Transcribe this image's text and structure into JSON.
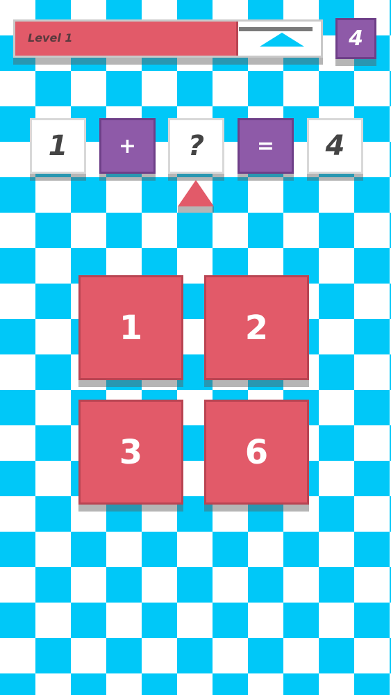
{
  "header": {
    "level_label": "Level 1",
    "progress_fraction": 0.73,
    "score": "4"
  },
  "equation": {
    "operand1": "1",
    "operator": "+",
    "unknown": "?",
    "equals": "=",
    "result": "4"
  },
  "answers": [
    "1",
    "2",
    "3",
    "6"
  ],
  "colors": {
    "background_pattern": "#00c8f8",
    "accent_red": "#e25a69",
    "accent_purple": "#8e5aa8",
    "tile_white": "#ffffff"
  },
  "icons": {
    "pointer": "triangle-up-icon",
    "progress_marker": "triangle-marker-icon"
  }
}
